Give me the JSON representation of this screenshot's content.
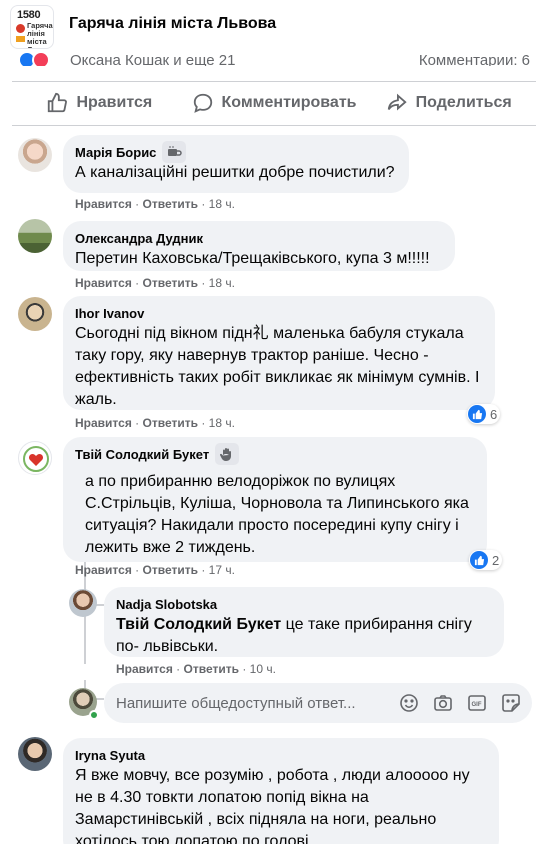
{
  "page": {
    "title": "Гаряча лінія міста Львова",
    "logo_number": "1580",
    "logo_text": "Гаряча лінія міста Львова"
  },
  "reactions": {
    "reactors": "Оксана Кошак и еще 21",
    "comments": "Комментарии: 6"
  },
  "actions": [
    {
      "label": "Нравится",
      "icon": "thumbs-up-icon"
    },
    {
      "label": "Комментировать",
      "icon": "comment-icon"
    },
    {
      "label": "Поделиться",
      "icon": "share-icon"
    }
  ],
  "meta_labels": {
    "like": "Нравится",
    "reply": "Ответить",
    "separator": "·"
  },
  "comments": [
    {
      "author": "Марія Борис",
      "badge": "coffee-cup-icon",
      "text": "А каналізаційні решитки добре почистили?",
      "time": "18 ч."
    },
    {
      "author": "Олександра Дудник",
      "text": "Перетин Каховська/Трещаківського, купа 3 м!!!!!",
      "time": "18 ч."
    },
    {
      "author": "Ihor Ivanov",
      "text": "Сьогодні під вікном підн礼 маленька бабуля стукала таку гору, яку навернув трактор раніше. Чесно - ефективність таких робіт викликає як мінімум сумнів. І жаль.",
      "time": "18 ч.",
      "likes": "6"
    },
    {
      "author": "Твій Солодкий Букет",
      "badge": "wave-hand-icon",
      "text": "а по прибиранню велодоріжок по вулицях С.Стрільців, Куліша, Чорновола та Липинського яка ситуація? Накидали просто посередині купу снігу і лежить вже 2 тиждень.",
      "time": "17 ч.",
      "likes": "2"
    },
    {
      "author": "Nadja Slobotska",
      "mention": "Твій Солодкий Букет",
      "text": " це таке прибирання снігу по- львівськи.",
      "time": "10 ч."
    },
    {
      "author": "Iryna Syuta",
      "text": "Я вже мовчу, все розумію , робота , люди алооооо ну не в 4.30 товкти лопатою попід вікна на Замарстинівській , всіх підняла на ноги, реально хотілось тою лопатою по голові"
    }
  ],
  "composer": {
    "placeholder": "Напишите общедоступный ответ..."
  },
  "colors": {
    "accent": "#1877f2",
    "bubble": "#f0f2f5",
    "meta": "#65676b"
  }
}
